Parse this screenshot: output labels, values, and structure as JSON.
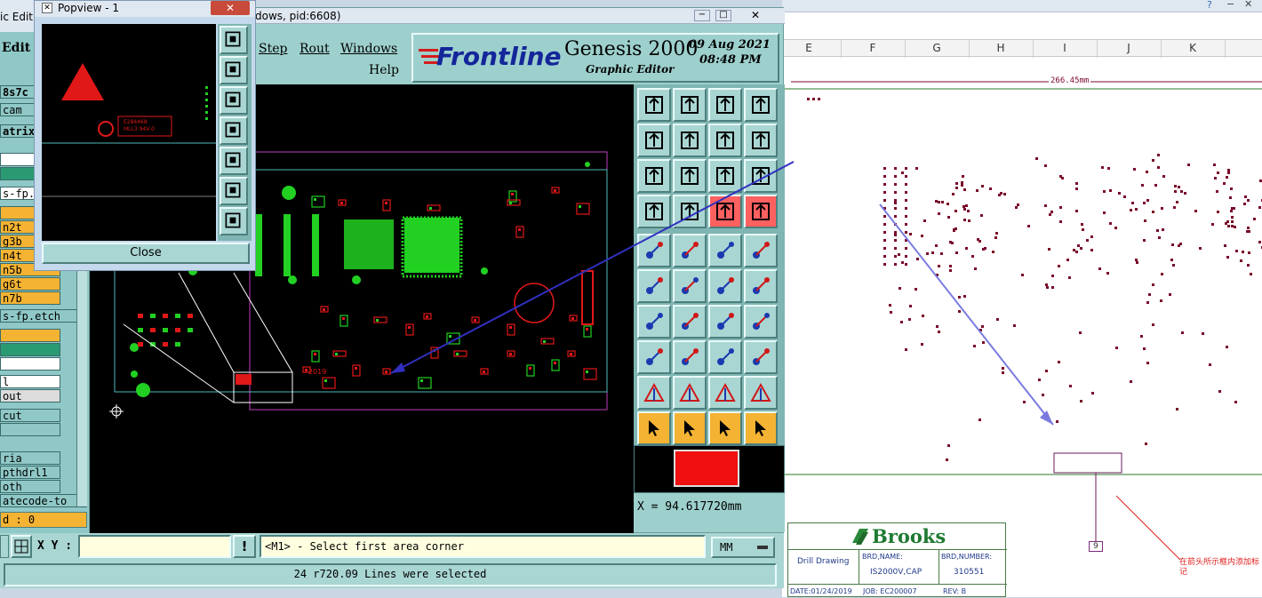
{
  "genesis": {
    "window_title_fragment": "dows, pid:6608)",
    "app_partial_title": "ic Edit",
    "menu": {
      "edit": "Edit",
      "step": "Step",
      "rout": "Rout",
      "windows": "Windows",
      "help": "Help"
    },
    "brand": "Frontline",
    "product": "Genesis 2000",
    "subtitle": "Graphic Editor",
    "date": "09 Aug 2021",
    "time": "08:48 PM",
    "coord_readout": "X = 94.617720mm",
    "xy_label": "X Y :",
    "prompt": "<M1> - Select first area corner",
    "units": "MM",
    "status_message": "24 r720.09 Lines were selected",
    "count_label": "d : 0"
  },
  "popview": {
    "title": "Popview - 1",
    "close_label": "Close"
  },
  "left_panel": {
    "items": [
      {
        "label": "8s7c",
        "color": "#8fc8c6"
      },
      {
        "label": "cam",
        "color": "#8fc8c6"
      },
      {
        "label": "atrix",
        "color": "#8fc8c6"
      },
      {
        "label": "",
        "color": "#ffffff"
      },
      {
        "label": "",
        "color": "#2a9a72"
      },
      {
        "label": "s-fp.e",
        "color": "#ffffff"
      },
      {
        "label": "",
        "color": "#f5b333"
      },
      {
        "label": "n2t",
        "color": "#f5b333"
      },
      {
        "label": "g3b",
        "color": "#f5b333"
      },
      {
        "label": "n4t",
        "color": "#f5b333"
      },
      {
        "label": "n5b",
        "color": "#f5b333"
      },
      {
        "label": "g6t",
        "color": "#f5b333"
      },
      {
        "label": "n7b",
        "color": "#f5b333"
      },
      {
        "label": "s-fp.etch",
        "color": "#8fc8c6"
      },
      {
        "label": "",
        "color": "#f5b333"
      },
      {
        "label": "",
        "color": "#2a9a72"
      },
      {
        "label": "",
        "color": "#ffffff"
      },
      {
        "label": "l",
        "color": "#ffffff"
      },
      {
        "label": "out",
        "color": "#dcdcdc"
      },
      {
        "label": "cut",
        "color": "#8fc8c6"
      },
      {
        "label": "",
        "color": "#8fc8c6"
      },
      {
        "label": "ria",
        "color": "#8fc8c6"
      },
      {
        "label": "pthdrl1",
        "color": "#8fc8c6"
      },
      {
        "label": "oth",
        "color": "#8fc8c6"
      },
      {
        "label": "atecode-to",
        "color": "#8fc8c6"
      }
    ]
  },
  "pcb_labels": {
    "chip_text1": "E284468",
    "chip_text2": "MLL3 94V-0",
    "year": "2019"
  },
  "document": {
    "columns": [
      "E",
      "F",
      "G",
      "H",
      "I",
      "J",
      "K"
    ],
    "dimension": "266.45mm",
    "callout_number": "9",
    "note": "在箭头所示框内添加标记",
    "title_block": {
      "company": "Brooks",
      "drawing_type": "Drill Drawing",
      "brd_name_label": "BRD,NAME:",
      "brd_name": "IS2000V,CAP",
      "brd_number_label": "BRD,NUMBER:",
      "brd_number": "310551",
      "date": "DATE:01/24/2019",
      "job": "JOB: EC200007",
      "rev": "REV: B"
    }
  },
  "colors": {
    "board_green": "#22d022",
    "board_red": "#e01818",
    "outline_magenta": "#c040c0",
    "drill_maroon": "#7a0a2a",
    "arrow_blue": "#2a2ac8"
  }
}
